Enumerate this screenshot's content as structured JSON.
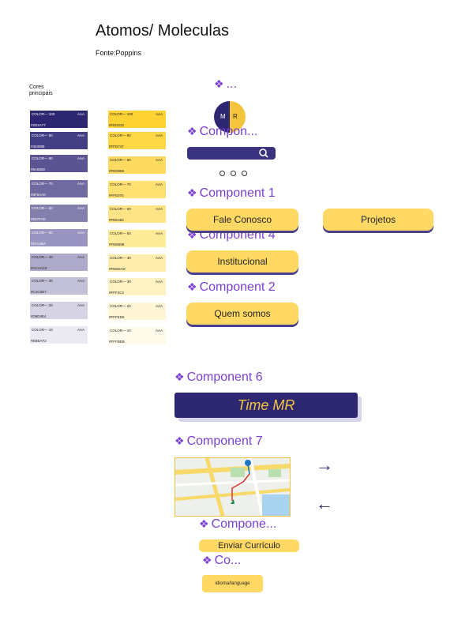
{
  "header": {
    "title": "Atomos/ Moleculas",
    "subtitle": "Fonte:Poppins",
    "cores_label": "Cores principais"
  },
  "palette": {
    "purple": [
      {
        "name": "COLOR— 100",
        "grade": "AAA",
        "hex": "#2D2A77",
        "color": "#2d2670",
        "text": "#ffffff"
      },
      {
        "name": "COLOR— 90",
        "grade": "AAA",
        "hex": "#434085",
        "color": "#433f85",
        "text": "#ffffff"
      },
      {
        "name": "COLOR— 80",
        "grade": "AAA",
        "hex": "#5A5592",
        "color": "#5a5592",
        "text": "#ffffff"
      },
      {
        "name": "COLOR— 70",
        "grade": "AAA",
        "hex": "#6F6AA0",
        "color": "#6f6aa0",
        "text": "#ffffff"
      },
      {
        "name": "COLOR— 60",
        "grade": "AAA",
        "hex": "#827FAD",
        "color": "#827fad",
        "text": "#ffffff"
      },
      {
        "name": "COLOR— 50",
        "grade": "AAA",
        "hex": "#97A4BA",
        "color": "#9995c0",
        "text": "#ffffff"
      },
      {
        "name": "COLOR— 40",
        "grade": "AAA",
        "hex": "#ACAAC8",
        "color": "#acaac8",
        "text": "#222222"
      },
      {
        "name": "COLOR— 30",
        "grade": "AAA",
        "hex": "#C1C0D7",
        "color": "#c1c0d7",
        "text": "#222222"
      },
      {
        "name": "COLOR— 20",
        "grade": "AAA",
        "hex": "#D6D4E4",
        "color": "#d6d4e4",
        "text": "#222222"
      },
      {
        "name": "COLOR— 10",
        "grade": "AAA",
        "hex": "#EBEAF2",
        "color": "#ebeaf2",
        "text": "#222222"
      }
    ],
    "yellow": [
      {
        "name": "COLOR— 100",
        "grade": "AAA",
        "hex": "#FED232",
        "color": "#fed232",
        "text": "#222222"
      },
      {
        "name": "COLOR— 90",
        "grade": "AAA",
        "hex": "#FFD747",
        "color": "#ffd747",
        "text": "#222222"
      },
      {
        "name": "COLOR— 80",
        "grade": "AAA",
        "hex": "#FED858",
        "color": "#fedb5e",
        "text": "#222222"
      },
      {
        "name": "COLOR— 70",
        "grade": "AAA",
        "hex": "#FFE070",
        "color": "#ffe070",
        "text": "#222222"
      },
      {
        "name": "COLOR— 60",
        "grade": "AAA",
        "hex": "#FEE484",
        "color": "#fee484",
        "text": "#222222"
      },
      {
        "name": "COLOR— 50",
        "grade": "AAA",
        "hex": "#FEEB98",
        "color": "#feeb98",
        "text": "#222222"
      },
      {
        "name": "COLOR— 40",
        "grade": "AAA",
        "hex": "#FEEDAD",
        "color": "#feedad",
        "text": "#222222"
      },
      {
        "name": "COLOR— 30",
        "grade": "AAA",
        "hex": "#FFF2C2",
        "color": "#fff2c2",
        "text": "#222222"
      },
      {
        "name": "COLOR— 20",
        "grade": "AAA",
        "hex": "#FFFED6",
        "color": "#fff6d6",
        "text": "#222222"
      },
      {
        "name": "COLOR— 10",
        "grade": "AAA",
        "hex": "#FFFBEB",
        "color": "#fffbeb",
        "text": "#222222"
      }
    ]
  },
  "components": {
    "top_label": "...",
    "avatar": {
      "left": "M",
      "right": "R"
    },
    "compon_label_1": "Compon...",
    "component1": "Component 1",
    "component4": "Component 4",
    "component2": "Component 2",
    "component6": "Component 6",
    "component7": "Component 7",
    "compone_label": "Compone...",
    "co_label": "Co..."
  },
  "buttons": {
    "fale_conosco": "Fale Conosco",
    "projetos": "Projetos",
    "institucional": "Institucional",
    "quem_somos": "Quem somos",
    "enviar": "Enviar Currículo",
    "idioma": "idioma/language"
  },
  "banner": {
    "text": "Time MR"
  },
  "icons": {
    "diamond": "❖",
    "arrow_right": "→",
    "arrow_left": "←"
  },
  "colors": {
    "primary": "#2d2670",
    "accent": "#ffd964",
    "label": "#7a3fd1"
  }
}
